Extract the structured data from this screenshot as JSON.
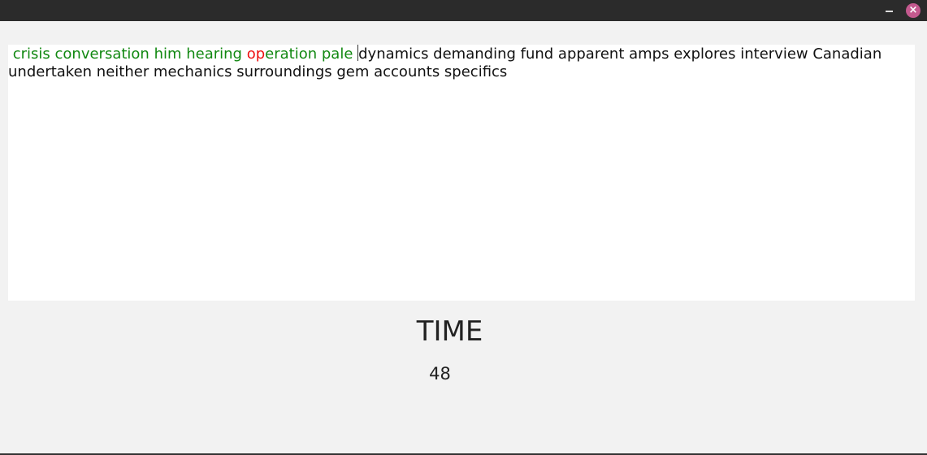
{
  "window": {
    "minimize_icon": "minimize-icon",
    "close_icon": "close-icon"
  },
  "typing": {
    "correct_1": " crisis conversation him hearing ",
    "wrong": "op",
    "correct_2": "eration pale ",
    "remaining": "dynamics demanding fund apparent amps explores interview Canadian undertaken neither mechanics surroundings gem accounts specifics"
  },
  "timer": {
    "label": "TIME",
    "value": "48"
  },
  "colors": {
    "correct": "#118811",
    "wrong": "#ee1111"
  }
}
